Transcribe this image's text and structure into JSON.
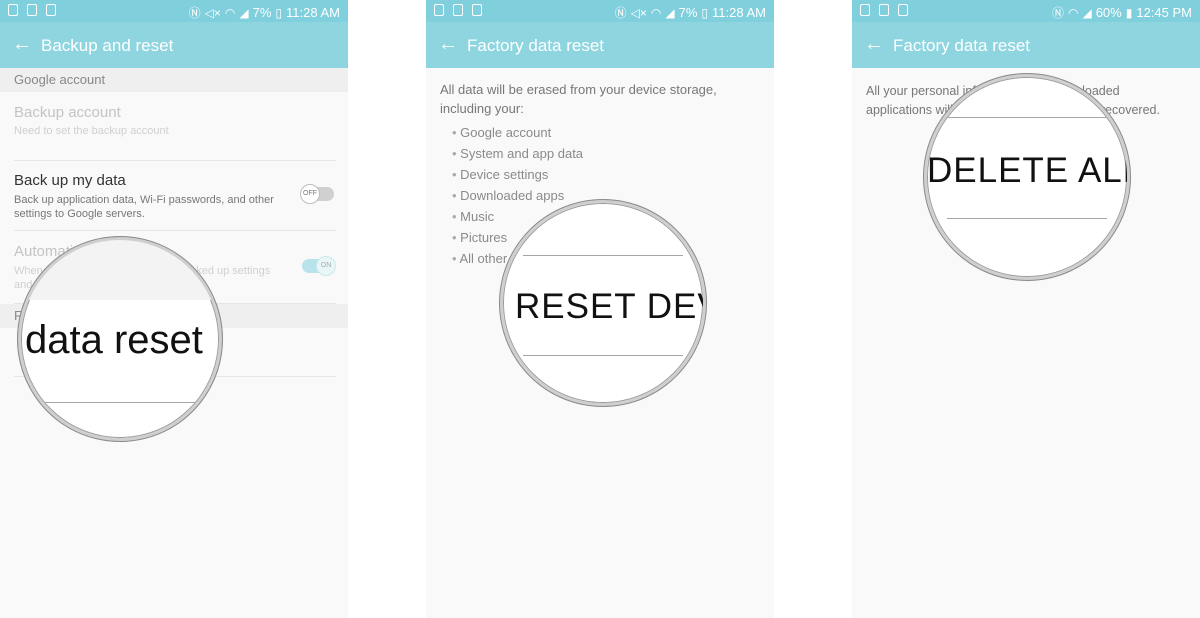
{
  "panels": [
    {
      "status": {
        "battery": "7%",
        "time": "11:28 AM"
      },
      "appbar_title": "Backup and reset",
      "section1": "Google account",
      "backup_account": {
        "title": "Backup account",
        "sub": "Need to set the backup account"
      },
      "backup_data": {
        "title": "Back up my data",
        "sub": "Back up application data, Wi-Fi passwords, and other settings to Google servers.",
        "toggle": "OFF"
      },
      "auto_restore": {
        "title": "Automatic restore",
        "sub": "When reinstalling an app, restore backed up settings and data",
        "toggle": "ON"
      },
      "section2": "Reset",
      "magnifier_text": "data reset"
    },
    {
      "status": {
        "battery": "7%",
        "time": "11:28 AM"
      },
      "appbar_title": "Factory data reset",
      "intro": "All data will be erased from your device storage, including your:",
      "bullets": [
        "Google account",
        "System and app data",
        "Device settings",
        "Downloaded apps",
        "Music",
        "Pictures",
        "All other"
      ],
      "magnifier_text": "RESET DEV"
    },
    {
      "status": {
        "battery": "60%",
        "time": "12:45 PM"
      },
      "appbar_title": "Factory data reset",
      "intro_line1": "All your personal information and downloaded",
      "intro_line2": "applications will be deleted and cannot be recovered.",
      "magnifier_text": "DELETE ALL"
    }
  ],
  "colors": {
    "statusbar": "#7fcfdc",
    "appbar": "#8ed5e0",
    "background": "#f9f9f9"
  },
  "icons": [
    "image-icon",
    "warning-icon",
    "sd-card-icon",
    "nfc-icon",
    "mute-icon",
    "wifi-icon",
    "signal-icon",
    "battery-icon",
    "back-arrow-icon"
  ]
}
